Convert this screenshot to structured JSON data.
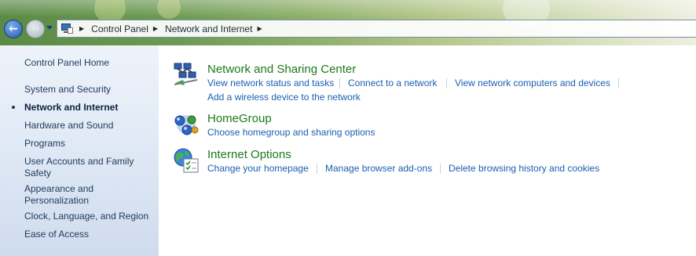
{
  "colors": {
    "accent_link": "#1a5fb4",
    "category_title": "#1c7a1c",
    "nav_text": "#1e395b"
  },
  "nav": {
    "back_icon": "arrow-left-icon",
    "forward_icon": "arrow-right-icon",
    "back_glyph": "←",
    "forward_glyph": "→",
    "breadcrumb": [
      "Control Panel",
      "Network and Internet"
    ]
  },
  "sidebar": {
    "items": [
      {
        "label": "Control Panel Home",
        "active": false
      },
      {
        "label": "System and Security",
        "active": false
      },
      {
        "label": "Network and Internet",
        "active": true
      },
      {
        "label": "Hardware and Sound",
        "active": false
      },
      {
        "label": "Programs",
        "active": false
      },
      {
        "label": "User Accounts and Family Safety",
        "active": false
      },
      {
        "label": "Appearance and Personalization",
        "active": false
      },
      {
        "label": "Clock, Language, and Region",
        "active": false
      },
      {
        "label": "Ease of Access",
        "active": false
      }
    ]
  },
  "categories": [
    {
      "title": "Network and Sharing Center",
      "icon": "network-sharing-icon",
      "tasks": [
        "View network status and tasks",
        "Connect to a network",
        "View network computers and devices",
        "Add a wireless device to the network"
      ]
    },
    {
      "title": "HomeGroup",
      "icon": "homegroup-icon",
      "tasks": [
        "Choose homegroup and sharing options"
      ]
    },
    {
      "title": "Internet Options",
      "icon": "internet-options-icon",
      "tasks": [
        "Change your homepage",
        "Manage browser add-ons",
        "Delete browsing history and cookies"
      ]
    }
  ]
}
